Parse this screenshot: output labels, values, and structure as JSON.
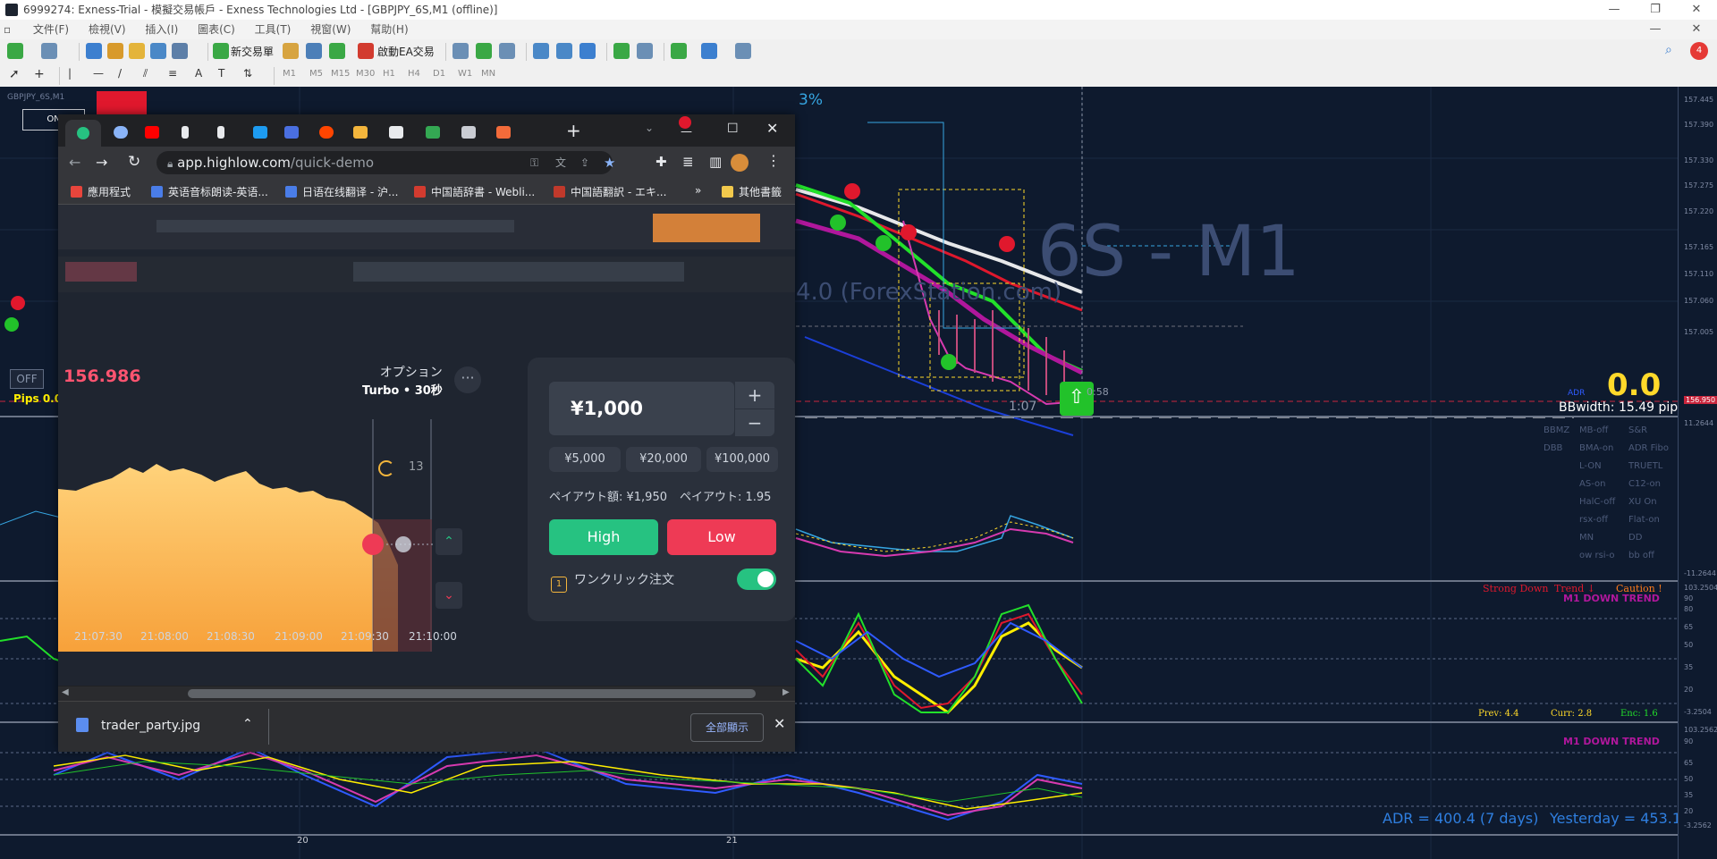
{
  "mt4": {
    "title": "6999274: Exness-Trial - 模擬交易帳戶 - Exness Technologies Ltd - [GBPJPY_6S,M1 (offline)]",
    "menu": [
      "文件(F)",
      "檢視(V)",
      "插入(I)",
      "圖表(C)",
      "工具(T)",
      "視窗(W)",
      "幫助(H)"
    ],
    "toolbar": {
      "new_order": "新交易單",
      "auto_trade": "啟動EA交易"
    },
    "timeframes": [
      "M1",
      "M5",
      "M15",
      "M30",
      "H1",
      "H4",
      "D1",
      "W1",
      "MN"
    ],
    "notification_count": "4"
  },
  "chart": {
    "symbol_label": "GBPJPY_6S,M1",
    "percent_label": "3%",
    "watermark_symbol": "6S - M1",
    "watermark_sub": "4.0 (ForexStation.com)",
    "on_button": "ON",
    "off_button": "OFF",
    "pips_label": "Pips 0.0",
    "bid_box_time": "0:58",
    "bar_time": "1:07",
    "adr_small_label": "ADR",
    "big_zero": "0.0",
    "bbwidth": "BBwidth: 15.49 pips",
    "indicator_buttons": [
      [
        "BBMZ",
        "MB-off",
        "S&R"
      ],
      [
        "DBB",
        "BMA-on",
        "ADR Fibo"
      ],
      [
        "",
        "L-ON",
        "TRUETL"
      ],
      [
        "",
        "AS-on",
        "C12-on"
      ],
      [
        "",
        "HalC-off",
        "XU On"
      ],
      [
        "",
        "rsx-off",
        "Flat-on"
      ],
      [
        "",
        "MN",
        "DD"
      ],
      [
        "",
        "ow rsi-o",
        "bb off"
      ]
    ],
    "trend_labels": {
      "strong_down": "Strong Down",
      "trend": "Trend ↓",
      "caution": "Caution !"
    },
    "m1_down_trend": "M1 DOWN TREND",
    "m1_down_trend_2": "M1 DOWN TREND",
    "prev": "Prev: 4.4",
    "curr": "Curr: 2.8",
    "enc": "Enc: 1.6",
    "adr": "ADR = 400.4  (7 days)",
    "yesterday": "Yesterday = 453.1",
    "date_labels": [
      "20",
      "21"
    ],
    "price_ticks": [
      "157.445",
      "157.390",
      "157.330",
      "157.275",
      "157.220",
      "157.165",
      "157.110",
      "157.060",
      "157.005",
      "156.950",
      "11.2644",
      "-11.2644",
      "103.2504",
      "90",
      "80",
      "65",
      "50",
      "35",
      "20",
      "-3.2504",
      "103.2562",
      "90",
      "65",
      "50",
      "35",
      "20",
      "-3.2562"
    ]
  },
  "browser": {
    "url_host": "app.highlow.com",
    "url_path": "/quick-demo",
    "bookmarks": [
      "應用程式",
      "英语音标朗读-英语...",
      "日语在线翻译 - 沪...",
      "中国語辞書 - Webli...",
      "中国語翻訳 - エキ...",
      "»",
      "其他書籤"
    ],
    "bookmark_colors": [
      "#e8453c",
      "#4a7de8",
      "#4a7de8",
      "#d23b2f",
      "#c0392b",
      "#e8eaed",
      "#f2c94c"
    ],
    "ticker_price": "156.986",
    "option_label": "オプション",
    "option_type": "Turbo • 30秒",
    "more": "···",
    "countdown": "13",
    "amount": "¥1,000",
    "plus": "+",
    "minus": "−",
    "presets": [
      "¥5,000",
      "¥20,000",
      "¥100,000"
    ],
    "payout_amount": "ペイアウト額: ¥1,950",
    "payout_rate": "ペイアウト: 1.95",
    "high_label": "High",
    "low_label": "Low",
    "one_click_label": "ワンクリック注文",
    "one_click_enabled": true,
    "times": [
      "21:07:30",
      "21:08:00",
      "21:08:30",
      "21:09:00",
      "21:09:30",
      "21:10:00"
    ],
    "download_file": "trader_party.jpg",
    "show_all": "全部顯示",
    "high_color": "#26c281",
    "low_color": "#ee3a55"
  }
}
